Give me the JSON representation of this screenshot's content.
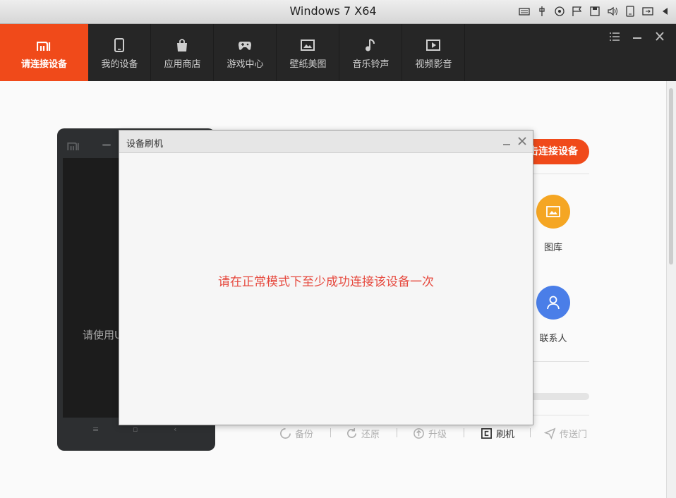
{
  "os": {
    "title": "Windows 7 X64"
  },
  "header": {
    "connect_label": "请连接设备",
    "nav": [
      {
        "label": "我的设备",
        "icon": "phone-icon"
      },
      {
        "label": "应用商店",
        "icon": "bag-icon"
      },
      {
        "label": "游戏中心",
        "icon": "gamepad-icon"
      },
      {
        "label": "壁纸美图",
        "icon": "picture-icon"
      },
      {
        "label": "音乐铃声",
        "icon": "music-note-icon"
      },
      {
        "label": "视频影音",
        "icon": "video-icon"
      }
    ]
  },
  "phone": {
    "hint": "请使用U"
  },
  "panel": {
    "connect_button": "击连接设备",
    "gallery_label": "图库",
    "contacts_label": "联系人",
    "tools": {
      "backup": "备份",
      "restore": "还原",
      "upgrade": "升级",
      "flash": "刷机",
      "transfer": "传送门"
    }
  },
  "dialog": {
    "title": "设备刷机",
    "message": "请在正常模式下至少成功连接该设备一次"
  },
  "colors": {
    "accent": "#f04a1a",
    "gallery": "#f5a623",
    "contacts": "#4a7ee8",
    "message": "#e6483d"
  }
}
